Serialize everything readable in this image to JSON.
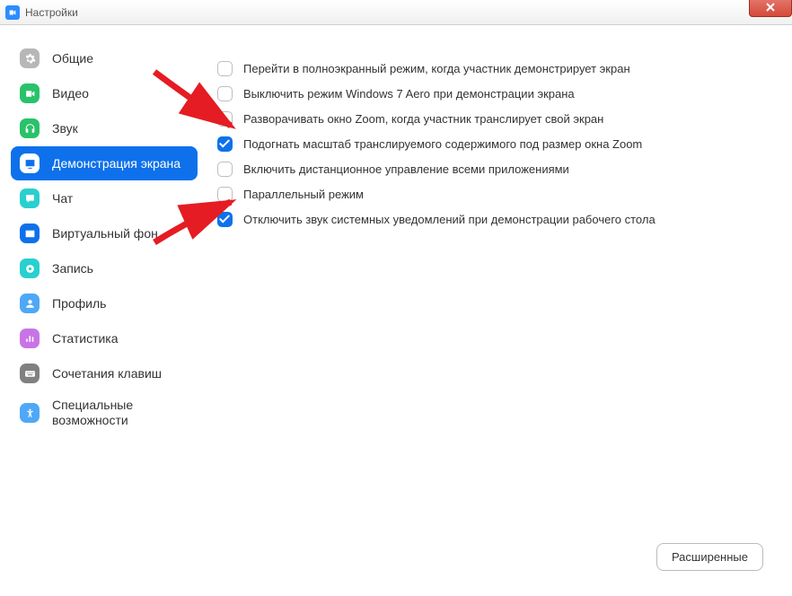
{
  "window": {
    "title": "Настройки"
  },
  "sidebar": {
    "items": [
      {
        "label": "Общие",
        "icon": "gear-icon",
        "color": "#b7b7b7"
      },
      {
        "label": "Видео",
        "icon": "video-icon",
        "color": "#29c26a"
      },
      {
        "label": "Звук",
        "icon": "headphones-icon",
        "color": "#29c26a"
      },
      {
        "label": "Демонстрация экрана",
        "icon": "share-screen-icon",
        "color": "#0E71EB",
        "active": true
      },
      {
        "label": "Чат",
        "icon": "chat-icon",
        "color": "#2acfcf"
      },
      {
        "label": "Виртуальный фон",
        "icon": "virtual-bg-icon",
        "color": "#0E71EB"
      },
      {
        "label": "Запись",
        "icon": "record-icon",
        "color": "#2acfcf"
      },
      {
        "label": "Профиль",
        "icon": "profile-icon",
        "color": "#4fa8f7"
      },
      {
        "label": "Статистика",
        "icon": "stats-icon",
        "color": "#c974e6"
      },
      {
        "label": "Сочетания клавиш",
        "icon": "keyboard-icon",
        "color": "#808080"
      },
      {
        "label": "Специальные возможности",
        "icon": "accessibility-icon",
        "color": "#4fa8f7",
        "multiline": true
      }
    ]
  },
  "options": [
    {
      "label": "Перейти в полноэкранный режим, когда участник демонстрирует экран",
      "checked": false
    },
    {
      "label": "Выключить режим Windows 7 Aero при демонстрации экрана",
      "checked": false
    },
    {
      "label": "Разворачивать окно Zoom, когда участник транслирует свой экран",
      "checked": false
    },
    {
      "label": "Подогнать масштаб транслируемого содержимого под размер окна Zoom",
      "checked": true
    },
    {
      "label": "Включить дистанционное управление всеми приложениями",
      "checked": false
    },
    {
      "label": "Параллельный режим",
      "checked": false
    },
    {
      "label": "Отключить звук системных уведомлений при демонстрации рабочего стола",
      "checked": true
    }
  ],
  "buttons": {
    "advanced": "Расширенные"
  },
  "colors": {
    "accent": "#0E71EB",
    "arrow": "#e51c23"
  }
}
